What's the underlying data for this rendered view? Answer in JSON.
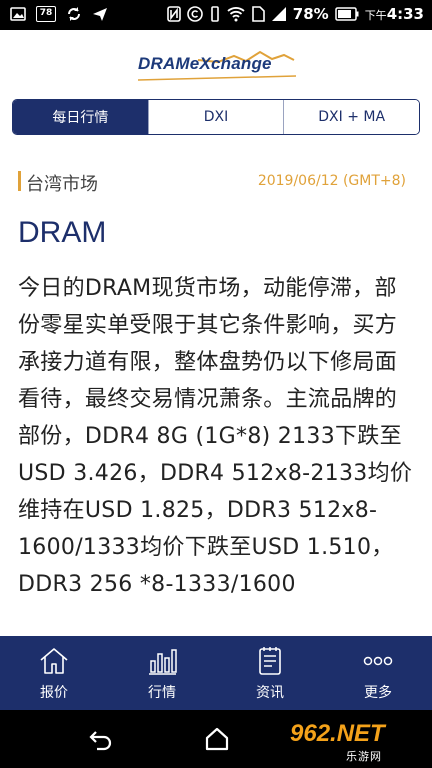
{
  "status_bar": {
    "left_icons": [
      "image-icon",
      "notification-badge-icon",
      "sync-icon",
      "send-icon"
    ],
    "badge_text": "78",
    "battery_percent": "78%",
    "time": "下午4:33",
    "time_prefix": "下午",
    "time_value": "4:33"
  },
  "header": {
    "logo_text": "DRAMeXchange"
  },
  "tabs": [
    {
      "label": "每日行情",
      "active": true
    },
    {
      "label": "DXI",
      "active": false
    },
    {
      "label": "DXI + MA",
      "active": false
    }
  ],
  "market": {
    "name": "台湾市场",
    "date": "2019/06/12 (GMT+8)"
  },
  "article": {
    "title": "DRAM",
    "body": "今日的DRAM现货市场，动能停滞，部份零星实单受限于其它条件影响，买方承接力道有限，整体盘势仍以下修局面看待，最终交易情况萧条。主流品牌的部份，DDR4 8G (1G*8) 2133下跌至USD 3.426，DDR4 512x8-2133均价维持在USD 1.825，DDR3 512x8-1600/1333均价下跌至USD 1.510，DDR3 256 *8-1333/1600"
  },
  "bottom_nav": [
    {
      "label": "报价",
      "icon": "home-icon"
    },
    {
      "label": "行情",
      "icon": "bar-chart-icon"
    },
    {
      "label": "资讯",
      "icon": "news-icon"
    },
    {
      "label": "更多",
      "icon": "more-icon"
    }
  ],
  "watermark": {
    "main": "962.NET",
    "sub": "乐游网"
  },
  "colors": {
    "navy": "#1d2f6b",
    "accent": "#e0a23a"
  }
}
